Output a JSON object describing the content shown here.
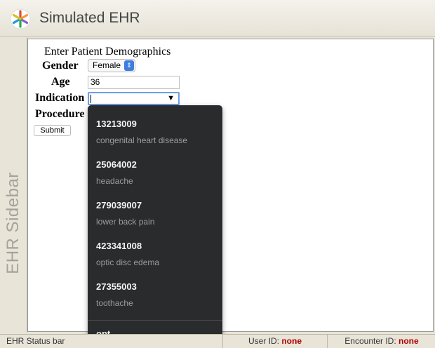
{
  "app": {
    "title": "Simulated EHR"
  },
  "sidebar": {
    "label": "EHR Sidebar"
  },
  "form": {
    "title": "Enter Patient Demographics",
    "gender": {
      "label": "Gender",
      "value": "Female"
    },
    "age": {
      "label": "Age",
      "value": "36"
    },
    "indication": {
      "label": "Indication",
      "value": ""
    },
    "procedure": {
      "label": "Procedure"
    },
    "submit_label": "Submit"
  },
  "dropdown": {
    "options": [
      {
        "code": "13213009",
        "description": "congenital heart disease"
      },
      {
        "code": "25064002",
        "description": "headache"
      },
      {
        "code": "279039007",
        "description": "lower back pain"
      },
      {
        "code": "423341008",
        "description": "optic disc edema"
      },
      {
        "code": "27355003",
        "description": "toothache"
      }
    ],
    "footer": "opt"
  },
  "status": {
    "label": "EHR Status bar",
    "user_label": "User ID:",
    "user_value": "none",
    "encounter_label": "Encounter ID:",
    "encounter_value": "none"
  },
  "colors": {
    "accent": "#3d7de0",
    "status_value": "#b00000",
    "dropdown_bg": "#2a2b2d"
  }
}
